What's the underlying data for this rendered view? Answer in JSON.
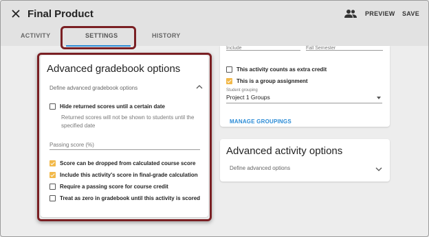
{
  "header": {
    "title": "Final Product",
    "close_icon": "close-icon",
    "people_icon": "people-icon",
    "preview_label": "PREVIEW",
    "save_label": "SAVE"
  },
  "tabs": [
    {
      "label": "ACTIVITY",
      "active": false
    },
    {
      "label": "SETTINGS",
      "active": true
    },
    {
      "label": "HISTORY",
      "active": false
    }
  ],
  "gradebook": {
    "title": "Advanced gradebook options",
    "subhead": "Define advanced gradebook options",
    "hide_scores": {
      "label": "Hide returned scores until a certain date",
      "checked": false
    },
    "hide_scores_helper": "Returned scores will not be shown to students until the specified date",
    "passing_score_label": "Passing score (%)",
    "passing_score_value": "",
    "options": [
      {
        "label": "Score can be dropped from calculated course score",
        "checked": true
      },
      {
        "label": "Include this activity's score in final-grade calculation",
        "checked": true
      },
      {
        "label": "Require a passing score for course credit",
        "checked": false
      },
      {
        "label": "Treat as zero in gradebook until this activity is scored",
        "checked": false
      }
    ]
  },
  "activity_settings": {
    "partial_field_1": "Include",
    "partial_field_2": "Fall Semester",
    "extra_credit": {
      "label": "This activity counts as extra credit",
      "checked": false
    },
    "group_assignment": {
      "label": "This is a group assignment",
      "checked": true
    },
    "student_grouping_label": "Student grouping",
    "student_grouping_value": "Project 1 Groups",
    "manage_groupings_label": "MANAGE GROUPINGS"
  },
  "advanced_activity": {
    "title": "Advanced activity options",
    "subhead": "Define advanced options"
  },
  "colors": {
    "accent": "#2a8bd6",
    "checkbox_checked": "#f2b94a",
    "highlight_border": "#7a1f23"
  }
}
